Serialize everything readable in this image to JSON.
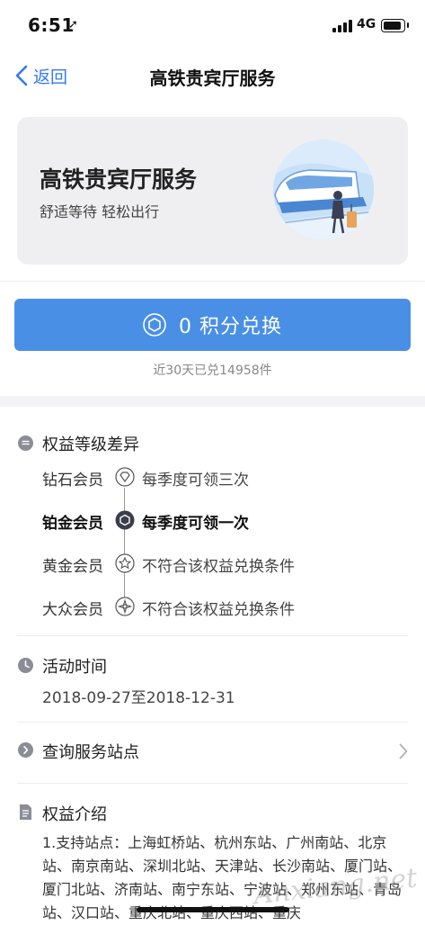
{
  "status_bar": {
    "time": "6:51",
    "network": "4G"
  },
  "nav": {
    "back_label": "返回",
    "title": "高铁贵宾厅服务"
  },
  "hero": {
    "title": "高铁贵宾厅服务",
    "subtitle": "舒适等待 轻松出行"
  },
  "exchange": {
    "button_label": "0 积分兑换",
    "redeemed_text": "近30天已兑14958件"
  },
  "tiers": {
    "title": "权益等级差异",
    "items": [
      {
        "name": "钻石会员",
        "desc": "每季度可领三次",
        "icon": "diamond-icon"
      },
      {
        "name": "铂金会员",
        "desc": "每季度可领一次",
        "icon": "hexagon-icon"
      },
      {
        "name": "黄金会员",
        "desc": "不符合该权益兑换条件",
        "icon": "star-icon"
      },
      {
        "name": "大众会员",
        "desc": "不符合该权益兑换条件",
        "icon": "compass-icon"
      }
    ]
  },
  "activity": {
    "title": "活动时间",
    "date": "2018-09-27至2018-12-31"
  },
  "query": {
    "label": "查询服务站点"
  },
  "intro": {
    "title": "权益介绍",
    "text": "1.支持站点：上海虹桥站、杭州东站、广州南站、北京站、南京南站、深圳北站、天津站、长沙南站、厦门站、厦门北站、济南站、南宁东站、宁波站、郑州东站、青岛站、汉口站、重庆北站、重庆西站、重庆"
  },
  "colors": {
    "accent": "#4a8fe6",
    "link": "#3478f6",
    "icon_gray": "#8a8d96"
  },
  "watermark": "Anxiang.net"
}
